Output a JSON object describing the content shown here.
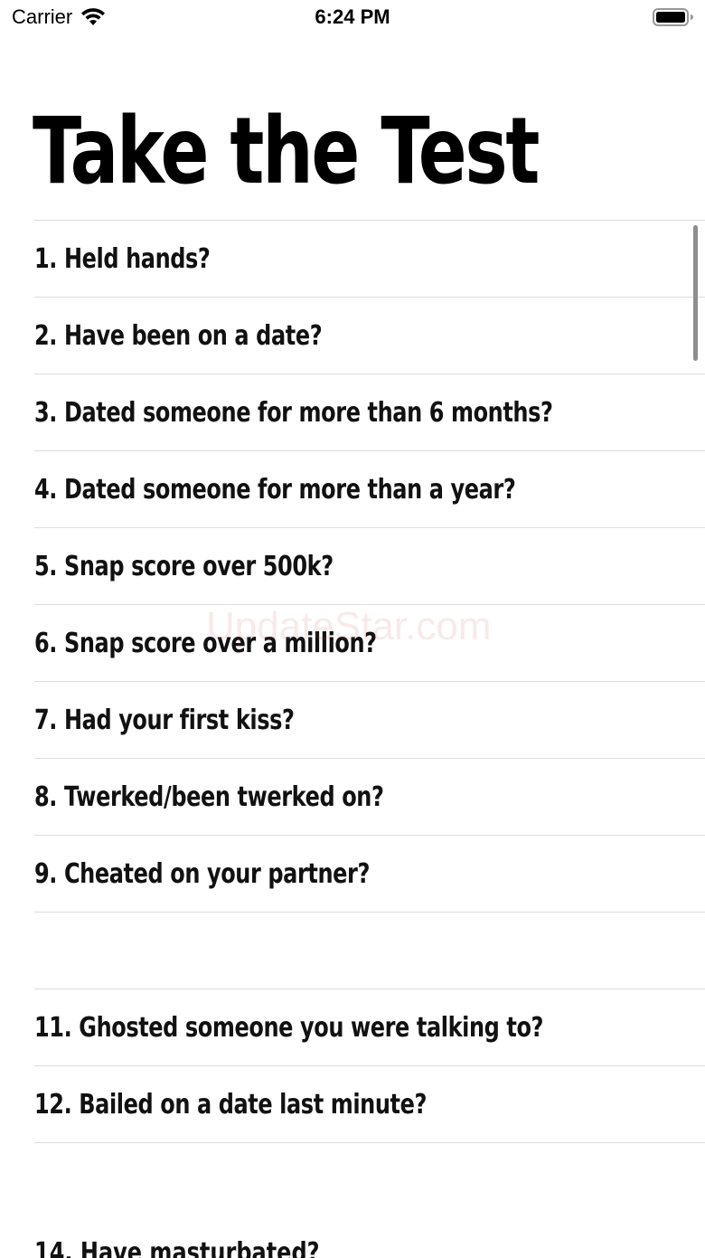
{
  "status_bar": {
    "carrier": "Carrier",
    "time": "6:24 PM",
    "wifi_icon": "wifi-icon",
    "battery_icon": "battery-icon"
  },
  "page": {
    "title": "Take the Test"
  },
  "questions": [
    "1. Held hands?",
    "2. Have been on a date?",
    "3. Dated someone for more than 6 months?",
    "4. Dated someone for more than a year?",
    "5. Snap score over 500k?",
    "6. Snap score over a million?",
    "7. Had your first kiss?",
    "8. Twerked/been twerked on?",
    "9. Cheated on your partner?",
    "",
    "11. Ghosted someone you were talking to?",
    "12. Bailed on a date last minute?",
    "",
    ""
  ],
  "partial_row": {
    "label": "14. Have masturbated?"
  },
  "watermark": "UpdateStar.com",
  "colors": {
    "separator": "#dddddd",
    "text": "#000000",
    "background": "#ffffff"
  }
}
